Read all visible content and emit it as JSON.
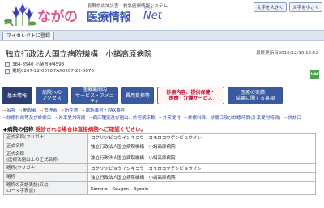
{
  "header": {
    "logo_text": "ながの",
    "subtitle": "長野県広域災害・救急医療情報システム",
    "system_title": "医療情報",
    "net_ruby": "ネット",
    "net_text": "Net",
    "font_buttons": [
      "文字を大きく",
      "文字を小さく"
    ]
  },
  "toolbar": {
    "mylist_label": "マイセレクトに登録"
  },
  "hospital": {
    "name": "独立行政法人国立病院機構　小諸高原病院",
    "updated": "最終更新日2010/12/10 16:52",
    "postal": "384-8540 小諸市甲4598",
    "phone": "電話0267-22-0870 FAX0267-22-0870",
    "map_label": "MAP"
  },
  "tabs": [
    {
      "label": "基本情報"
    },
    {
      "label": "病院への\nアクセス"
    },
    {
      "label": "医療機関内\nサービス・アメニティ"
    },
    {
      "label": "費用負担等"
    },
    {
      "label": "診療内容、提供保健・\n医療・介護サービス"
    },
    {
      "label": "医療の実績、\n結果に関する事項"
    }
  ],
  "subnav": {
    "row1": [
      "名称",
      "開設者",
      "管理者",
      "所在地",
      "電話番号・FAX番号"
    ],
    "row2": [
      "診療科目等及び診療日",
      "外来受付時間",
      "病床種別及び届出、許可病床数",
      "外来受付",
      "診療科目、診療日及び診療時間(外来受付時間)",
      "休診日"
    ]
  },
  "section": {
    "title": "◆病院の名称",
    "note": "受診される場合は直接病院へご確認ください。"
  },
  "table": [
    {
      "label": "正式名称(フリガナ)",
      "value": "コクリツビョウインキコウ　コモロコウゲンビョウイン"
    },
    {
      "label": "正式名称",
      "value": "独立行政法人国立病院機構　小諸高原病院"
    },
    {
      "label": "正式名称\n(医療法届出上の正式名称)",
      "value": "独立行政法人国立病院機構　小諸高原病院"
    },
    {
      "label": "略称(フリガナ)",
      "value": "コクリツビョウインキコウ　コモロコウゲンビョウイン"
    },
    {
      "label": "略称",
      "value": "独立行政法人国立病院機構　小諸高原病院"
    },
    {
      "label": "略称の英語表記(又は\nローマ字表記)",
      "value": "Komoro　Kougen　Byouin"
    }
  ],
  "colors": {
    "logo_pink": "#e05890",
    "brand_blue": "#3b55b0",
    "tab_blue": "#3a5aa0",
    "active_red": "#c01030"
  }
}
